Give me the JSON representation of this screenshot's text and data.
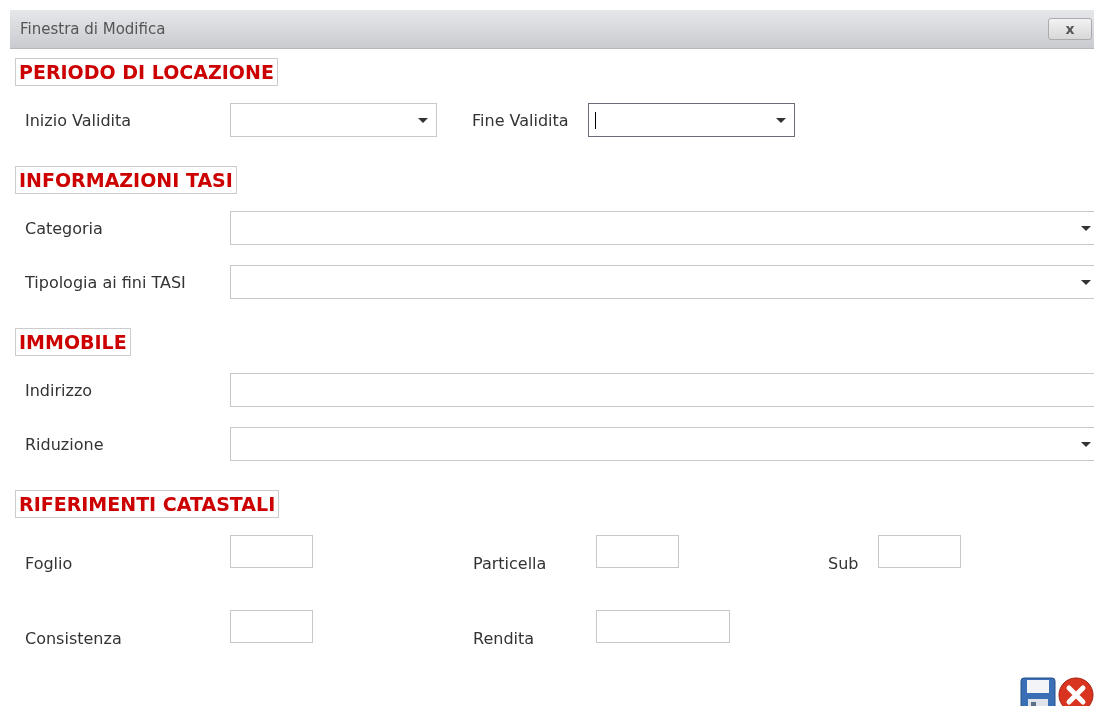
{
  "window": {
    "title": "Finestra di Modifica",
    "close_label": "x"
  },
  "sections": [
    {
      "heading": "PERIODO DI LOCAZIONE",
      "kind": "fields",
      "rows": [
        [
          {
            "label": "Inizio Validita",
            "kind": "dropdown",
            "focused": false
          },
          {
            "label": "Fine Validita",
            "kind": "dropdown",
            "focused": true
          }
        ]
      ]
    },
    {
      "heading": "INFORMAZIONI TASI",
      "kind": "fields",
      "rows": [
        [
          {
            "label": "Categoria",
            "kind": "dropdown",
            "focused": false
          }
        ],
        [
          {
            "label": "Tipologia ai fini TASI",
            "kind": "dropdown",
            "focused": false
          }
        ]
      ]
    },
    {
      "heading": "IMMOBILE",
      "kind": "fields",
      "rows": [
        [
          {
            "label": "Indirizzo",
            "kind": "text",
            "focused": false
          }
        ],
        [
          {
            "label": "Riduzione",
            "kind": "dropdown",
            "focused": false
          }
        ]
      ]
    },
    {
      "heading": "RIFERIMENTI CATASTALI",
      "kind": "grid",
      "rows": [
        [
          {
            "label": "Foglio",
            "kind": "short",
            "focused": false
          },
          {
            "label": "Particella",
            "kind": "short",
            "focused": false
          },
          {
            "label": "Sub",
            "kind": "short",
            "focused": false
          }
        ],
        [
          {
            "label": "Consistenza",
            "kind": "short",
            "focused": false
          },
          {
            "label": "Rendita",
            "kind": "medium",
            "focused": false
          }
        ]
      ]
    }
  ],
  "actions": [
    {
      "kind": "save"
    },
    {
      "kind": "cancel"
    }
  ]
}
